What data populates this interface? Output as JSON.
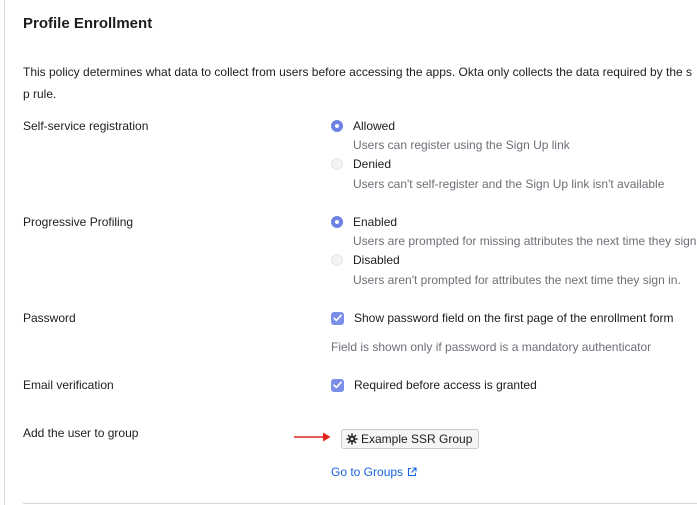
{
  "section": {
    "title": "Profile Enrollment",
    "description": "This policy determines what data to collect from users before accessing the apps. Okta only collects the data required by the sp rule."
  },
  "self_service": {
    "label": "Self-service registration",
    "options": [
      {
        "label": "Allowed",
        "hint": "Users can register using the Sign Up link",
        "selected": true
      },
      {
        "label": "Denied",
        "hint": "Users can't self-register and the Sign Up link isn't available",
        "selected": false
      }
    ]
  },
  "progressive": {
    "label": "Progressive Profiling",
    "options": [
      {
        "label": "Enabled",
        "hint": "Users are prompted for missing attributes the next time they sign",
        "selected": true
      },
      {
        "label": "Disabled",
        "hint": "Users aren't prompted for attributes the next time they sign in.",
        "selected": false
      }
    ]
  },
  "password": {
    "label": "Password",
    "checkbox_label": "Show password field on the first page of the enrollment form",
    "checked": true,
    "hint": "Field is shown only if password is a mandatory authenticator"
  },
  "email": {
    "label": "Email verification",
    "checkbox_label": "Required before access is granted",
    "checked": true
  },
  "group": {
    "label": "Add the user to group",
    "chip": "Example SSR Group",
    "link": "Go to Groups"
  },
  "colors": {
    "accent": "#6e82e6",
    "link": "#1662dd",
    "arrow": "#e0241b"
  }
}
